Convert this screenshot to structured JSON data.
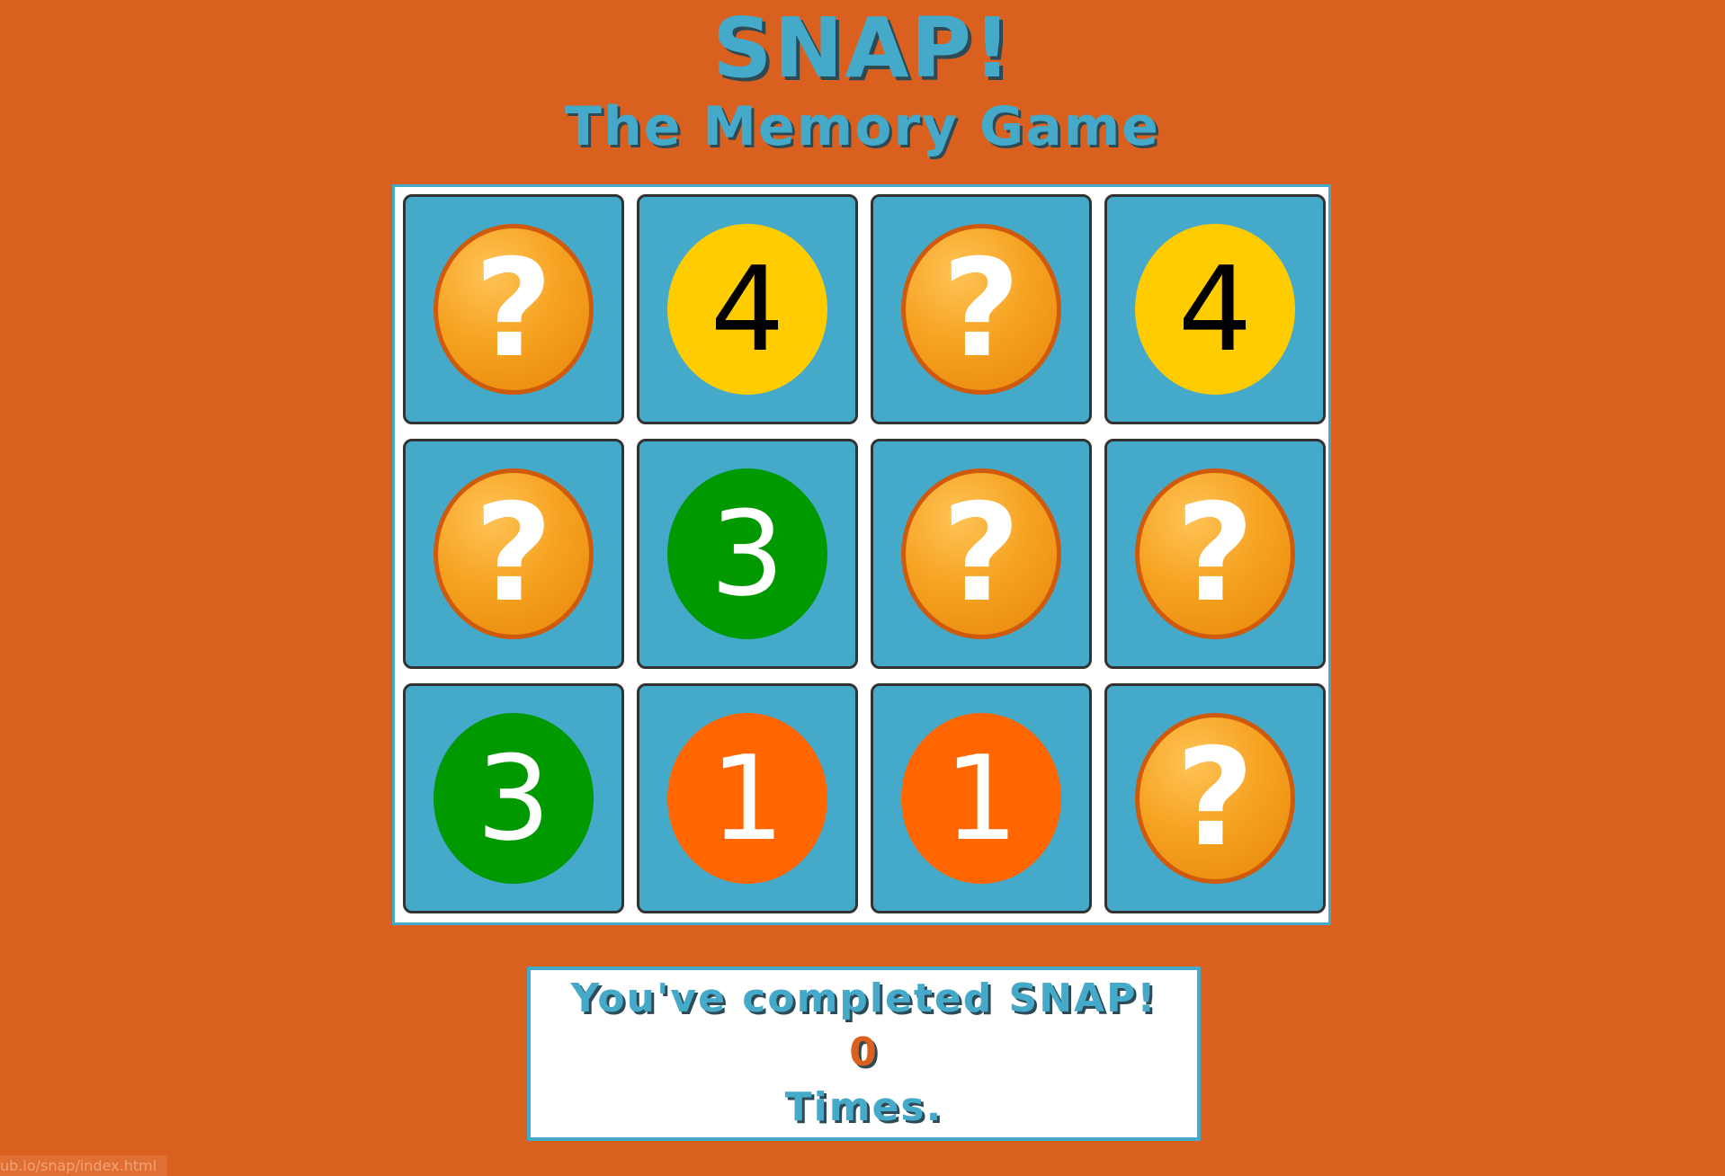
{
  "header": {
    "title": "SNAP!",
    "subtitle": "The Memory Game"
  },
  "colors": {
    "background": "#d9601f",
    "card": "#45a9c9",
    "hidden_disc": "#f6a322",
    "yellow": "#ffcc00",
    "green": "#009900",
    "orange": "#ff6600"
  },
  "board": {
    "rows": 3,
    "columns": 4,
    "cards": [
      {
        "state": "hidden",
        "label": "?",
        "icon": "question-mark-icon"
      },
      {
        "state": "revealed",
        "label": "4",
        "disc_color": "#ffcc00",
        "text_color": "#000000"
      },
      {
        "state": "hidden",
        "label": "?",
        "icon": "question-mark-icon"
      },
      {
        "state": "revealed",
        "label": "4",
        "disc_color": "#ffcc00",
        "text_color": "#000000"
      },
      {
        "state": "hidden",
        "label": "?",
        "icon": "question-mark-icon"
      },
      {
        "state": "revealed",
        "label": "3",
        "disc_color": "#009900",
        "text_color": "#ffffff"
      },
      {
        "state": "hidden",
        "label": "?",
        "icon": "question-mark-icon"
      },
      {
        "state": "hidden",
        "label": "?",
        "icon": "question-mark-icon"
      },
      {
        "state": "revealed",
        "label": "3",
        "disc_color": "#009900",
        "text_color": "#ffffff"
      },
      {
        "state": "revealed",
        "label": "1",
        "disc_color": "#ff6600",
        "text_color": "#ffffff"
      },
      {
        "state": "revealed",
        "label": "1",
        "disc_color": "#ff6600",
        "text_color": "#ffffff"
      },
      {
        "state": "hidden",
        "label": "?",
        "icon": "question-mark-icon"
      }
    ]
  },
  "result": {
    "message": "You've completed SNAP!",
    "count": "0",
    "unit": "Times."
  },
  "status_bar": {
    "url": "ub.io/snap/index.html"
  }
}
